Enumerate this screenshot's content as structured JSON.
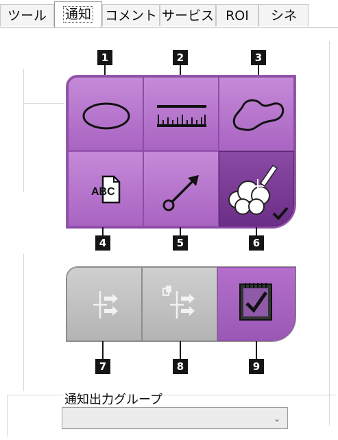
{
  "tabs": [
    {
      "label": "ツール",
      "active": false
    },
    {
      "label": "通知",
      "active": true
    },
    {
      "label": "コメント",
      "active": false
    },
    {
      "label": "サービス",
      "active": false
    },
    {
      "label": "ROI",
      "active": false
    },
    {
      "label": "シネ",
      "active": false
    }
  ],
  "callouts": [
    "1",
    "2",
    "3",
    "4",
    "5",
    "6",
    "7",
    "8",
    "9"
  ],
  "tools": {
    "ellipse": {
      "icon": "ellipse-icon"
    },
    "ruler": {
      "icon": "ruler-icon"
    },
    "freehand": {
      "icon": "freehand-icon"
    },
    "text": {
      "icon": "text-abc-icon",
      "text": "ABC"
    },
    "arrow": {
      "icon": "arrow-icon"
    },
    "cloud": {
      "icon": "cloud-pen-icon",
      "selected": true
    },
    "cine7": {
      "icon": "step-icon",
      "enabled": false
    },
    "cine8": {
      "icon": "copy-step-icon",
      "enabled": false
    },
    "notes": {
      "icon": "notepad-check-icon",
      "enabled": true
    }
  },
  "output_group": {
    "label": "通知出力グループ",
    "value": ""
  },
  "colors": {
    "purple": "#b070c8",
    "purple_dark": "#6b2e86",
    "gray": "#bdbdbd"
  }
}
